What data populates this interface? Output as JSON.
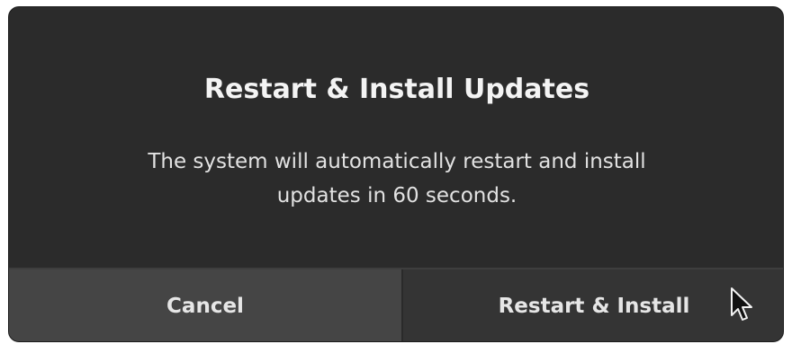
{
  "dialog": {
    "title": "Restart & Install Updates",
    "body": "The system will automatically restart and install updates in 60 seconds.",
    "buttons": {
      "cancel_label": "Cancel",
      "confirm_label": "Restart & Install"
    }
  },
  "icons": {
    "cursor": "mouse-pointer-icon"
  },
  "colors": {
    "dialog_background": "#2b2b2b",
    "cancel_button_background": "#454545",
    "confirm_button_background": "#343434",
    "text": "#f4f4f4"
  }
}
